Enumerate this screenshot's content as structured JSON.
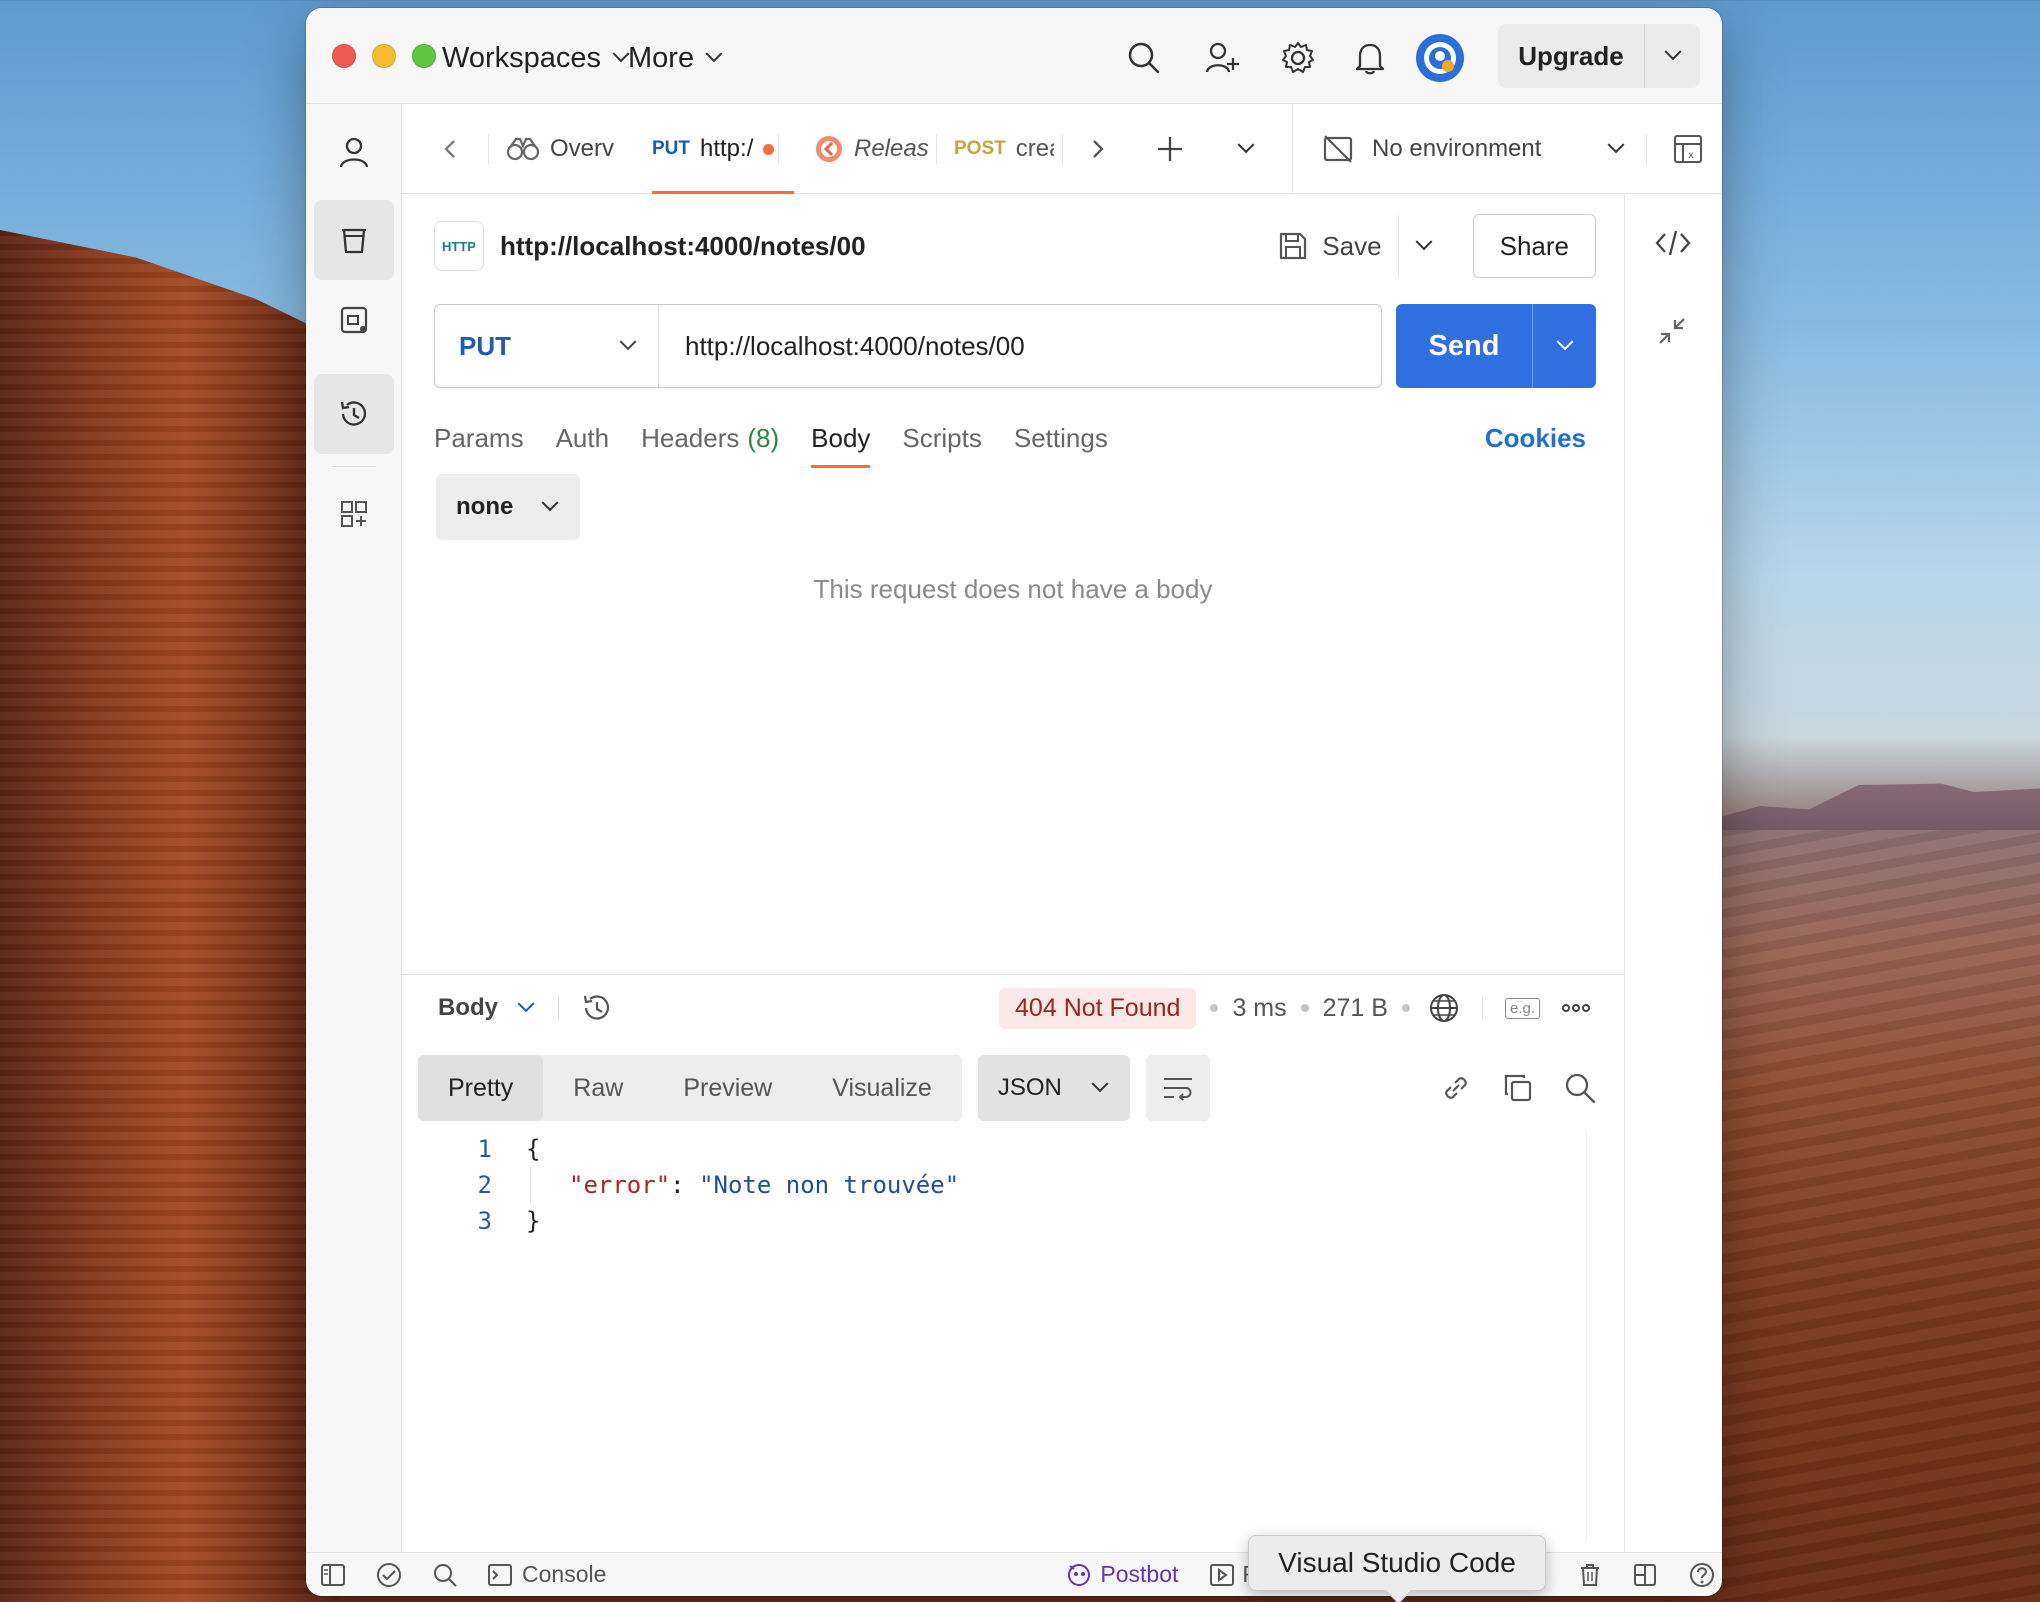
{
  "titlebar": {
    "workspaces_label": "Workspaces",
    "more_label": "More",
    "upgrade_label": "Upgrade"
  },
  "tabs": [
    {
      "method": "",
      "label": "Overv",
      "icon": "binoculars-icon"
    },
    {
      "method": "PUT",
      "label": "http:/",
      "unsaved": true
    },
    {
      "method": "",
      "label": "Releas",
      "icon": "release-icon"
    },
    {
      "method": "POST",
      "label": "crea"
    }
  ],
  "environment": {
    "label": "No environment"
  },
  "request": {
    "title": "http://localhost:4000/notes/00",
    "save_label": "Save",
    "share_label": "Share",
    "method": "PUT",
    "url": "http://localhost:4000/notes/00",
    "send_label": "Send",
    "tabs": {
      "params": "Params",
      "auth": "Auth",
      "headers": "Headers",
      "headers_count": "(8)",
      "body": "Body",
      "scripts": "Scripts",
      "settings": "Settings"
    },
    "cookies_label": "Cookies",
    "body_type": "none",
    "empty_body_message": "This request does not have a body",
    "http_badge": "HTTP"
  },
  "response": {
    "body_label": "Body",
    "status": "404 Not Found",
    "time": "3 ms",
    "size": "271 B",
    "example_badge": "e.g.",
    "views": [
      "Pretty",
      "Raw",
      "Preview",
      "Visualize"
    ],
    "format": "JSON",
    "code_lines": [
      {
        "num": "1",
        "text": "{"
      },
      {
        "num": "2",
        "key": "\"error\"",
        "colon": ": ",
        "value": "\"Note non trouvée\""
      },
      {
        "num": "3",
        "text": "}"
      }
    ]
  },
  "statusbar": {
    "console_label": "Console",
    "postbot_label": "Postbot",
    "runner_label": "R"
  },
  "tooltip": {
    "label": "Visual Studio Code"
  },
  "colors": {
    "accent": "#ff6c37",
    "send": "#2f6fe0",
    "put": "#1a5bb8",
    "post": "#c9a23a",
    "error": "#a0241a"
  }
}
